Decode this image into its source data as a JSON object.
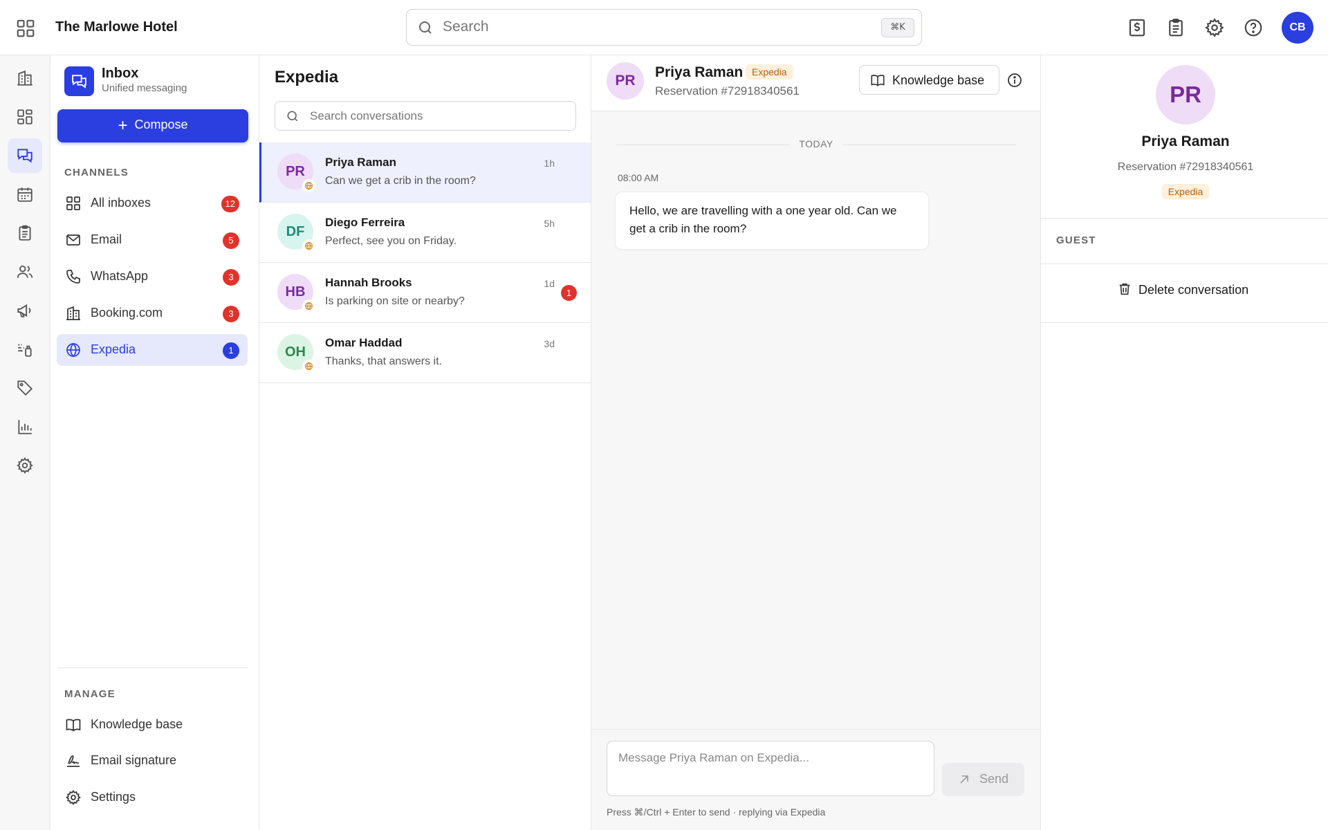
{
  "app": {
    "hotel_name": "The Marlowe Hotel",
    "search_placeholder": "Search",
    "search_shortcut": "⌘K",
    "user_initials": "CB",
    "accent": "#2b3ee0",
    "badge_red": "#e0332b"
  },
  "topbar_icons": [
    "apps-grid-icon",
    "billing-icon",
    "clipboard-icon",
    "settings-icon",
    "help-icon"
  ],
  "rail_icons": [
    "building-icon",
    "dashboard-icon",
    "messages-icon",
    "calendar-icon",
    "clipboard-icon",
    "guests-icon",
    "megaphone-icon",
    "automation-icon",
    "tag-icon",
    "analytics-icon",
    "settings-icon"
  ],
  "sidebar": {
    "title": "Inbox",
    "subtitle": "Unified messaging",
    "compose_label": "Compose",
    "channels_label": "CHANNELS",
    "channels": [
      {
        "label": "All inboxes",
        "badge": "12",
        "icon": "grid-icon"
      },
      {
        "label": "Email",
        "badge": "5",
        "icon": "mail-icon"
      },
      {
        "label": "WhatsApp",
        "badge": "3",
        "icon": "phone-icon"
      },
      {
        "label": "Booking.com",
        "badge": "3",
        "icon": "building-icon"
      },
      {
        "label": "Expedia",
        "badge": "1",
        "icon": "globe-icon",
        "active": true
      }
    ],
    "manage_label": "MANAGE",
    "manage": [
      {
        "label": "Knowledge base",
        "icon": "book-icon"
      },
      {
        "label": "Email signature",
        "icon": "signature-icon"
      },
      {
        "label": "Settings",
        "icon": "gear-icon"
      }
    ]
  },
  "conversations": {
    "title": "Expedia",
    "search_placeholder": "Search conversations",
    "items": [
      {
        "initials": "PR",
        "name": "Priya Raman",
        "snippet": "Can we get a crib in the room?",
        "time": "1h",
        "unread": "",
        "avatar_bg": "#efdcf6",
        "avatar_fg": "#7a2a9c"
      },
      {
        "initials": "DF",
        "name": "Diego Ferreira",
        "snippet": "Perfect, see you on Friday.",
        "time": "5h",
        "unread": "",
        "avatar_bg": "#d8f4ef",
        "avatar_fg": "#1e8a7a"
      },
      {
        "initials": "HB",
        "name": "Hannah Brooks",
        "snippet": "Is parking on site or nearby?",
        "time": "1d",
        "unread": "1",
        "avatar_bg": "#efdcf6",
        "avatar_fg": "#7a2a9c"
      },
      {
        "initials": "OH",
        "name": "Omar Haddad",
        "snippet": "Thanks, that answers it.",
        "time": "3d",
        "unread": "",
        "avatar_bg": "#dcf4e4",
        "avatar_fg": "#2a8a4e"
      }
    ]
  },
  "chat": {
    "initials": "PR",
    "name": "Priya Raman",
    "channel_tag": "Expedia",
    "reservation": "Reservation #72918340561",
    "kb_button": "Knowledge base",
    "day_label": "TODAY",
    "message_time": "08:00 AM",
    "message_text": "Hello, we are travelling with a one year old. Can we get a crib in the room?",
    "input_placeholder": "Message Priya Raman on Expedia...",
    "send_label": "Send",
    "hint": "Press ⌘/Ctrl + Enter to send · replying via Expedia"
  },
  "guest": {
    "initials": "PR",
    "name": "Priya Raman",
    "reservation": "Reservation #72918340561",
    "channel_tag": "Expedia",
    "section_label": "GUEST",
    "delete_label": "Delete conversation"
  }
}
